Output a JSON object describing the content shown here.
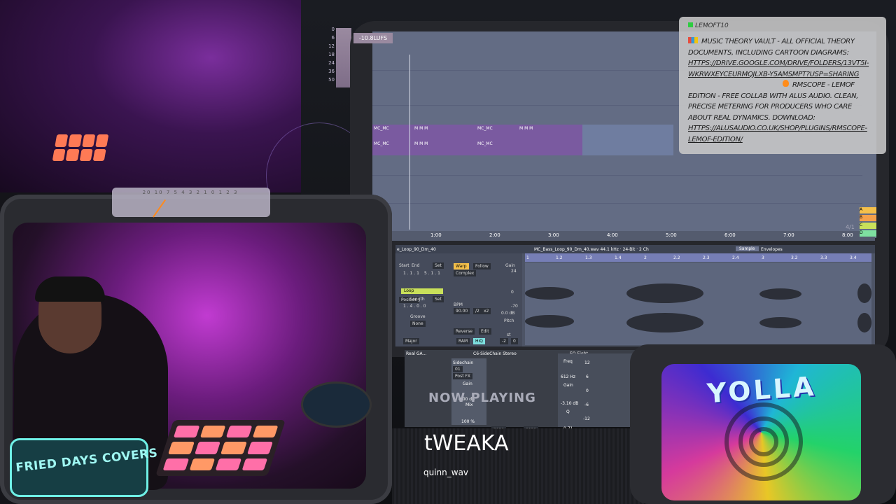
{
  "overlay": {
    "meter_scale": "20 10 7 5 4 3 2 1 0 1 2 3",
    "lufs_badge": "-10.8LUFS",
    "lufs_scale": [
      "0",
      "6",
      "12",
      "18",
      "24",
      "36",
      "50"
    ]
  },
  "daw": {
    "ruler_ticks": [
      "1:00",
      "2:00",
      "3:00",
      "4:00",
      "5:00",
      "6:00",
      "7:00",
      "8:00"
    ],
    "time_sig": "4/1",
    "clip_labels": [
      "MC_MC",
      "M M M",
      "MC_MC",
      "M M M"
    ],
    "clip_name": "e_Loop_90_Dm_40",
    "file_info": "MC_Bass_Loop_90_Dm_40.wav 44.1 kHz · 24-Bit · 2 Ch",
    "tabs": [
      "Sample",
      "Envelopes"
    ],
    "markers": [
      "1",
      "1.2",
      "1.3",
      "1.4",
      "2",
      "2.2",
      "2.3",
      "2.4",
      "3",
      "3.2",
      "3.3",
      "3.4"
    ],
    "controls": {
      "start_label": "Start",
      "end_label": "End",
      "set_label": "Set",
      "start_value": "1 . 1 . 1",
      "end_value": "5 . 1 . 1",
      "loop_label": "Loop",
      "position_label": "Position",
      "length_label": "Length",
      "length_value": "1 . 4 . 0 . 0",
      "groove_label": "Groove",
      "groove_value": "None",
      "warp_label": "Warp",
      "follow_label": "Follow",
      "warp_mode": "Complex",
      "bpm_label": "BPM",
      "bpm_value": "90.00",
      "half_label": "/2",
      "double_label": "x2",
      "gain_label": "Gain",
      "gain_value": "0.0 dB",
      "reverse_label": "Reverse",
      "edit_label": "Edit",
      "ram_label": "RAM",
      "hiq_label": "HiQ",
      "pitch_label": "Pitch",
      "pitch_value": "st",
      "transpose_value": "-2",
      "cents_value": "0",
      "key_label": "Major",
      "gain_scale": [
        "24",
        "0",
        "-70"
      ]
    },
    "side_chips": [
      "A",
      "B",
      "C",
      "D"
    ]
  },
  "devices": {
    "chain_labels": [
      "Real GA...",
      "C6-SideChain Stereo",
      "EQ Eight"
    ],
    "sidechain": {
      "label": "Sidechain",
      "input": "01",
      "post_fx": "Post FX",
      "gain_label": "Gain",
      "gain_value": "0.00 dB",
      "mix_label": "Mix",
      "mix_value": "100 %",
      "none_left": "none",
      "none_right": "none"
    },
    "eq": {
      "freq_label": "Freq",
      "freq_value": "612 Hz",
      "gain_label": "Gain",
      "gain_value": "-3.10 dB",
      "q_label": "Q",
      "q_value": "0.71",
      "scale": [
        "12",
        "6",
        "0",
        "-6",
        "-12"
      ]
    }
  },
  "now_playing": {
    "label": "NOW PLAYING",
    "title": "tWEAKA",
    "artist": "quinn_wav"
  },
  "chat": {
    "username": "LEMOFT10",
    "message_part1": "MUSIC THEORY VAULT - ALL OFFICIAL THEORY DOCUMENTS, INCLUDING CARTOON DIAGRAMS:",
    "link1": "HTTPS://DRIVE.GOOGLE.COM/DRIVE/FOLDERS/13VT5I-WKRWXEYCEURMQJLXB-Y5AMSMPT?USP=SHARING",
    "message_part2": "RMSCOPE - LEMOF EDITION - FREE COLLAB WITH ALUS AUDIO. CLEAN, PRECISE METERING FOR PRODUCERS WHO CARE ABOUT REAL DYNAMICS. DOWNLOAD:",
    "link2": "HTTPS://ALUSAUDIO.CO.UK/SHOP/PLUGINS/RMSCOPE-LEMOF-EDITION/"
  },
  "artwork": {
    "title": "YOLLA"
  },
  "logo": {
    "text": "FRIED DAYS COVERS"
  },
  "colors": {
    "accent": "#f5c04a",
    "clip_purple": "#7a5aa0",
    "loop_green": "#c9e05a",
    "hiq_cyan": "#7ee0e0"
  }
}
